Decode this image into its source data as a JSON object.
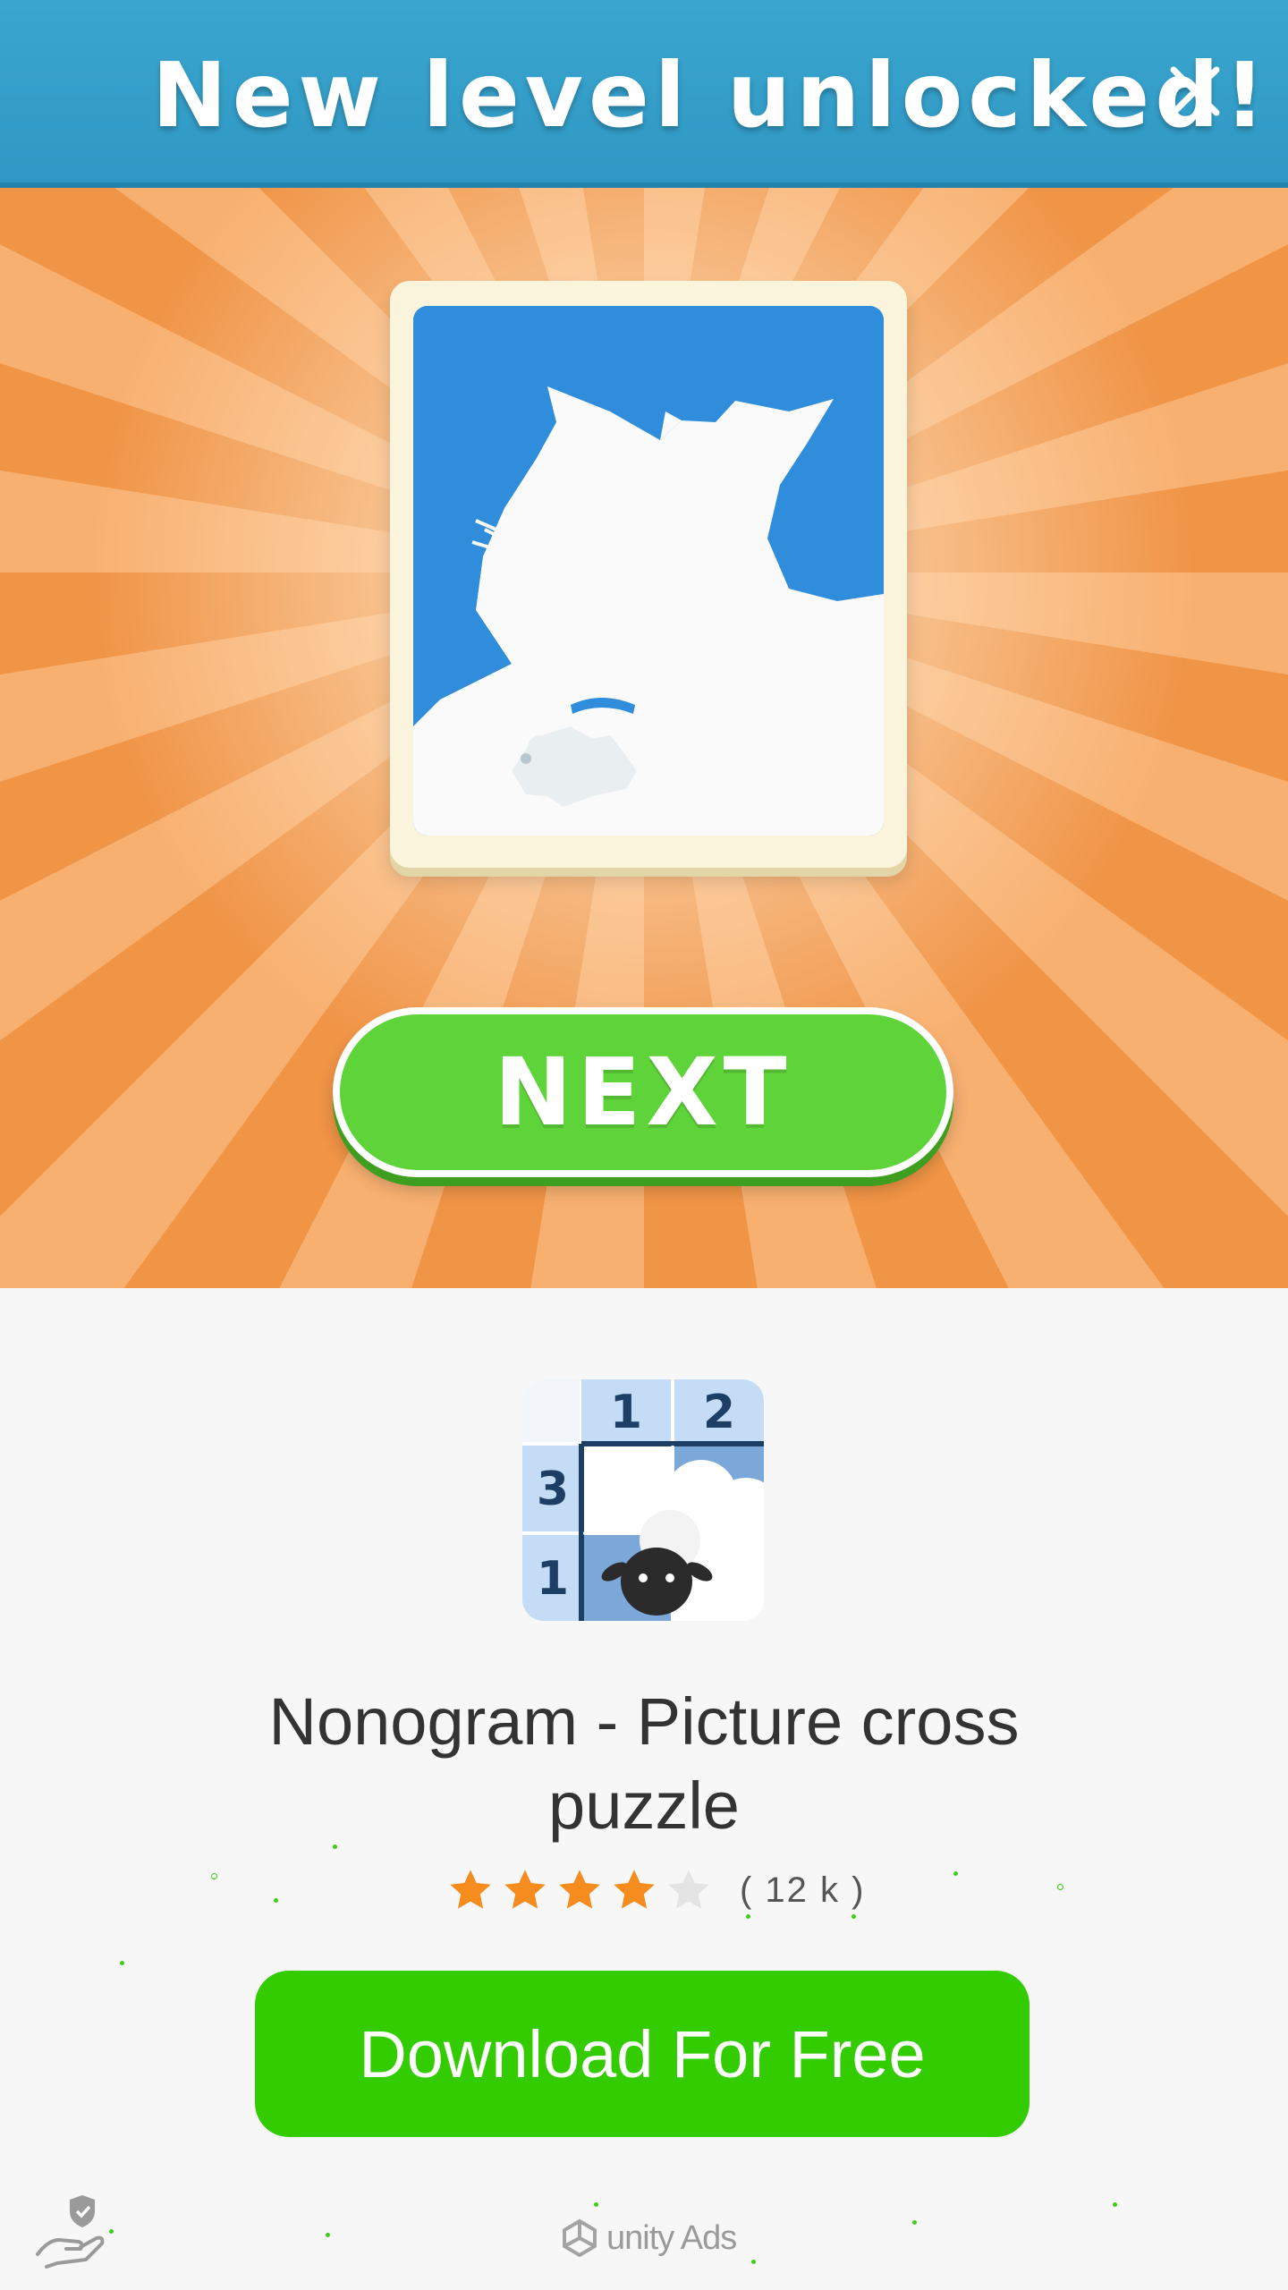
{
  "banner": {
    "title": "New level unlocked!",
    "close_icon": "close-icon"
  },
  "creative": {
    "picture": "level-silhouette-cat-and-mouse",
    "next_label": "NEXT"
  },
  "app": {
    "icon": "nonogram-app-icon",
    "icon_clues": {
      "col1": "1",
      "col2": "2",
      "row1": "3",
      "row2": "1"
    },
    "title": "Nonogram - Picture cross puzzle",
    "rating_stars": 4,
    "rating_max": 5,
    "rating_count": "( 12 k )",
    "download_label": "Download For Free"
  },
  "footer": {
    "privacy_icon": "privacy-shield-hand-icon",
    "unity_label": "unity Ads"
  },
  "colors": {
    "banner": "#2f98c4",
    "background_orange": "#f0994a",
    "next_green": "#5fd33a",
    "download_green": "#33cc00",
    "star_orange": "#f68c1e",
    "star_empty": "#e4e4e4"
  }
}
